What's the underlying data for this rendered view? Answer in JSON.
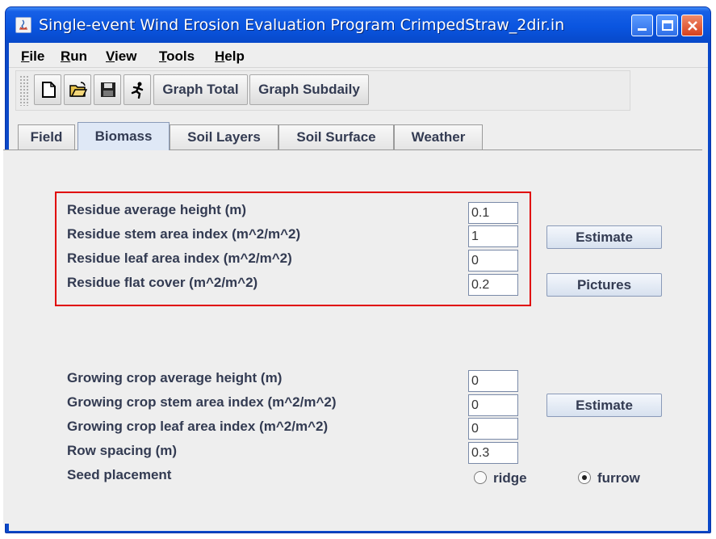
{
  "window": {
    "title": "Single-event Wind Erosion Evaluation Program CrimpedStraw_2dir.in"
  },
  "menubar": {
    "items": [
      {
        "mnemonic": "F",
        "rest": "ile"
      },
      {
        "mnemonic": "R",
        "rest": "un"
      },
      {
        "mnemonic": "V",
        "rest": "iew"
      },
      {
        "mnemonic": "T",
        "rest": "ools"
      },
      {
        "mnemonic": "H",
        "rest": "elp"
      }
    ]
  },
  "toolbar": {
    "icons": [
      "new-file-icon",
      "open-folder-icon",
      "save-disk-icon",
      "run-figure-icon"
    ],
    "graph_total": "Graph Total",
    "graph_subdaily": "Graph Subdaily"
  },
  "tabs": [
    {
      "label": "Field",
      "active": false
    },
    {
      "label": "Biomass",
      "active": true
    },
    {
      "label": "Soil Layers",
      "active": false
    },
    {
      "label": "Soil Surface",
      "active": false
    },
    {
      "label": "Weather",
      "active": false
    }
  ],
  "residue": {
    "height_label": "Residue average height (m)",
    "height_value": "0.1",
    "stem_label": "Residue stem area index (m^2/m^2)",
    "stem_value": "1",
    "leaf_label": "Residue leaf area index (m^2/m^2)",
    "leaf_value": "0",
    "flat_label": "Residue flat cover  (m^2/m^2)",
    "flat_value": "0.2",
    "estimate_button": "Estimate",
    "pictures_button": "Pictures"
  },
  "growing": {
    "height_label": "Growing crop average height (m)",
    "height_value": "0",
    "stem_label": "Growing crop stem area index (m^2/m^2)",
    "stem_value": "0",
    "leaf_label": "Growing crop leaf area index  (m^2/m^2)",
    "leaf_value": "0",
    "row_label": "Row spacing (m)",
    "row_value": "0.3",
    "seed_label": "Seed placement",
    "estimate_button": "Estimate",
    "seed_options": [
      {
        "label": "ridge",
        "selected": false
      },
      {
        "label": "furrow",
        "selected": true
      }
    ]
  },
  "colors": {
    "titlebar": "#0a55e0",
    "highlight_box": "#e00000",
    "label_text": "#333b52"
  }
}
